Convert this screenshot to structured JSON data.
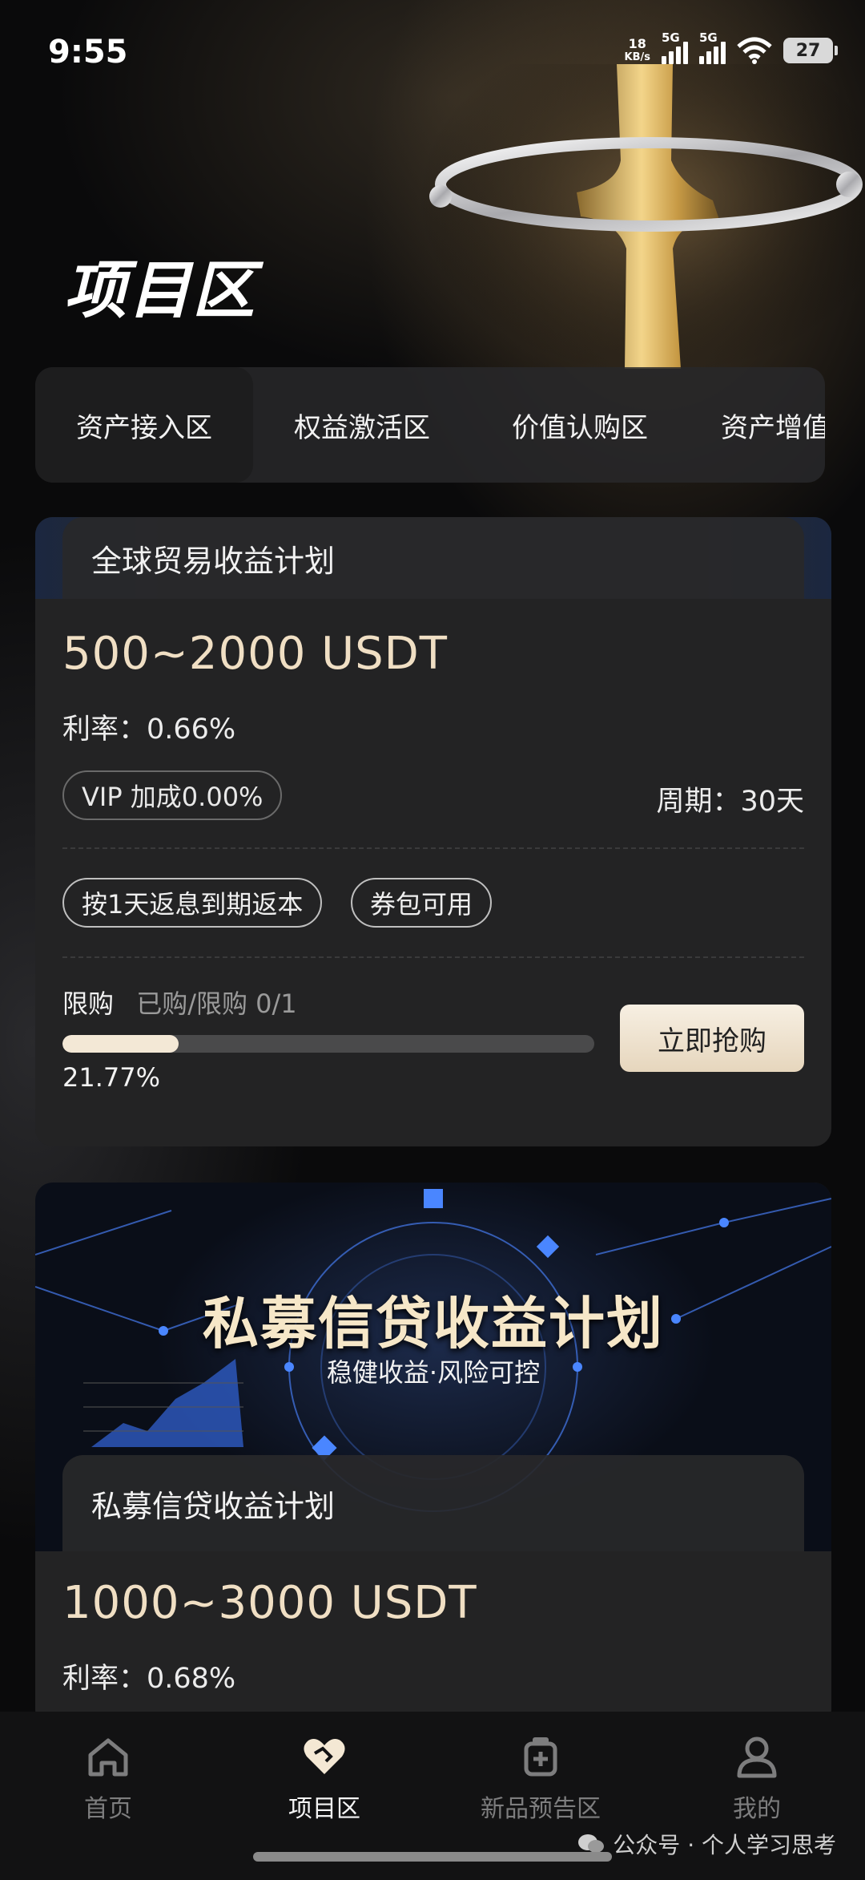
{
  "status_bar": {
    "time": "9:55",
    "speed_value": "18",
    "speed_unit": "KB/s",
    "net1": "5G",
    "net2": "5G",
    "battery": "27"
  },
  "header": {
    "title": "项目区"
  },
  "tabs": [
    "资产接入区",
    "权益激活区",
    "价值认购区",
    "资产增值"
  ],
  "card1": {
    "name": "全球贸易收益计划",
    "amount": "500~2000 USDT",
    "rate": "利率：0.66%",
    "vip": "VIP 加成0.00%",
    "period": "周期：30天",
    "tag1": "按1天返息到期返本",
    "tag2": "券包可用",
    "limit_label": "限购",
    "limit_value": "已购/限购 0/1",
    "progress_text": "21.77%",
    "progress": 0.2177,
    "buy_label": "立即抢购"
  },
  "card2": {
    "banner_title": "私募信贷收益计划",
    "banner_subtitle": "稳健收益·风险可控",
    "name": "私募信贷收益计划",
    "amount": "1000~3000 USDT",
    "rate": "利率：0.68%"
  },
  "nav": [
    {
      "label": "首页",
      "icon": "home-icon"
    },
    {
      "label": "项目区",
      "icon": "handshake-heart-icon"
    },
    {
      "label": "新品预告区",
      "icon": "box-plus-icon"
    },
    {
      "label": "我的",
      "icon": "user-icon"
    }
  ],
  "watermark": "公众号 · 个人学习思考",
  "colors": {
    "accent": "#f0dfc4",
    "bg": "#0a0a0b",
    "card": "#232324"
  }
}
